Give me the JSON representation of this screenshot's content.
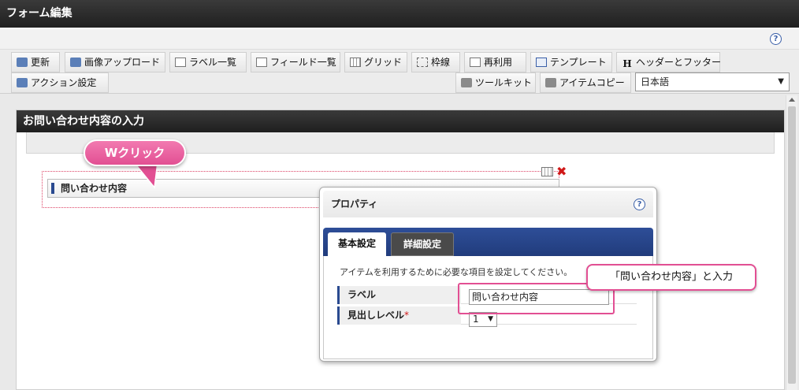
{
  "window": {
    "title": "フォーム編集"
  },
  "toolbar": {
    "items": [
      {
        "label": "更新",
        "icon": "refresh-icon"
      },
      {
        "label": "画像アップロード",
        "icon": "image-upload-icon"
      },
      {
        "label": "ラベル一覧",
        "icon": "label-list-icon"
      },
      {
        "label": "フィールド一覧",
        "icon": "field-list-icon"
      },
      {
        "label": "グリッド",
        "icon": "grid-icon"
      },
      {
        "label": "枠線",
        "icon": "border-icon"
      },
      {
        "label": "再利用",
        "icon": "reuse-icon"
      },
      {
        "label": "テンプレート",
        "icon": "template-icon"
      },
      {
        "label": "ヘッダーとフッター",
        "icon": "header-footer-icon"
      },
      {
        "label": "アクション設定",
        "icon": "action-icon"
      },
      {
        "label": "ツールキット",
        "icon": "toolkit-icon"
      },
      {
        "label": "アイテムコピー",
        "icon": "item-copy-icon"
      }
    ],
    "language": "日本語",
    "help": "?"
  },
  "form": {
    "title": "お問い合わせ内容の入力",
    "item_label": "問い合わせ内容"
  },
  "callouts": {
    "double_click": "Wクリック",
    "input_hint": "「問い合わせ内容」と入力"
  },
  "properties": {
    "title": "プロパティ",
    "help": "?",
    "tabs": [
      "基本設定",
      "詳細設定"
    ],
    "description": "アイテムを利用するために必要な項目を設定してください。",
    "label_key": "ラベル",
    "label_value": "問い合わせ内容",
    "heading_key": "見出しレベル",
    "required_mark": "*",
    "heading_value": "1"
  },
  "colors": {
    "accent_pink": "#e24f93",
    "tab_blue": "#2e4e98",
    "title_dark": "#2a2a2a",
    "delete_red": "#d01818"
  }
}
